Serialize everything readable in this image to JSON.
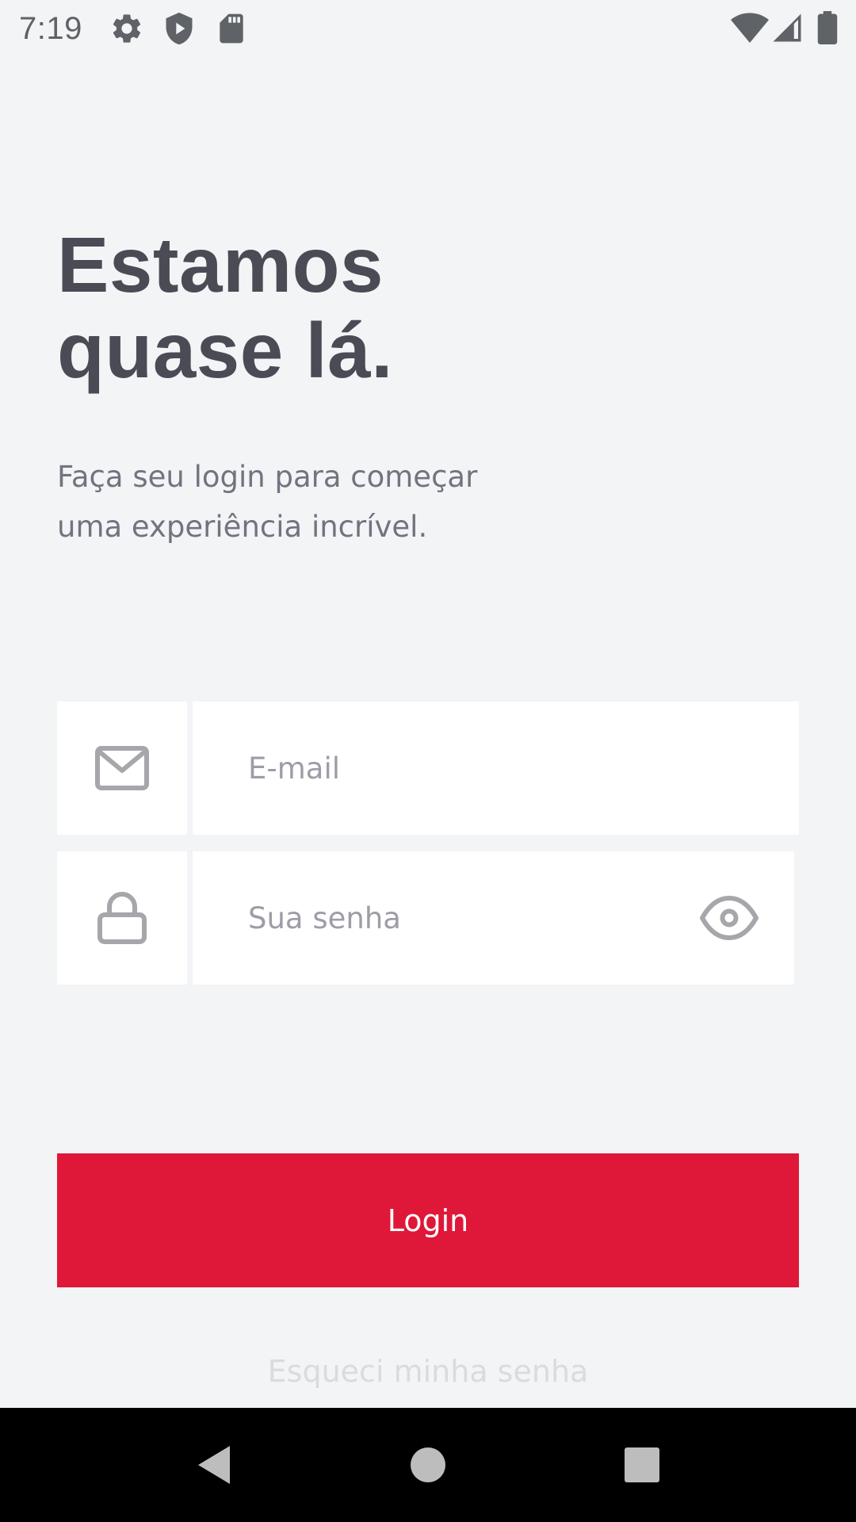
{
  "status_bar": {
    "time": "7:19",
    "left_icons": [
      "gear-icon",
      "shield-play-icon",
      "sd-card-icon"
    ],
    "right_icons": [
      "wifi-icon",
      "cellular-signal-icon",
      "battery-icon"
    ],
    "icon_color": "#5f6368"
  },
  "header": {
    "title_line_1": "Estamos",
    "title_line_2": "quase lá.",
    "subtitle_line_1": "Faça seu login para começar",
    "subtitle_line_2": "uma experiência incrível."
  },
  "form": {
    "email": {
      "icon": "mail-icon",
      "value": "",
      "placeholder": "E-mail"
    },
    "password": {
      "icon": "lock-icon",
      "value": "",
      "placeholder": "Sua senha",
      "toggle_icon": "eye-icon"
    },
    "login_label": "Login",
    "forgot_label": "Esqueci minha senha"
  },
  "colors": {
    "background": "#f3f4f6",
    "accent": "#df1738",
    "title": "#4a4b55",
    "subtitle": "#737380",
    "placeholder": "#9d9da8",
    "icon": "#a6a6ab",
    "forgot_link": "#dadbe0"
  },
  "nav_bar": {
    "buttons": [
      "back-icon",
      "home-icon",
      "recents-icon"
    ]
  }
}
